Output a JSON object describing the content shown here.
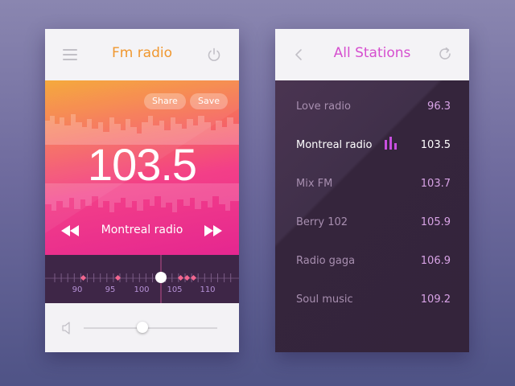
{
  "radio": {
    "title": "Fm radio",
    "share_label": "Share",
    "save_label": "Save",
    "frequency": "103.5",
    "station_name": "Montreal radio",
    "tuner_labels": [
      "90",
      "95",
      "100",
      "105",
      "110"
    ],
    "volume_fraction": 0.44
  },
  "stations": {
    "title": "All Stations",
    "items": [
      {
        "name": "Love radio",
        "freq": "96.3"
      },
      {
        "name": "Montreal radio",
        "freq": "103.5",
        "active": true
      },
      {
        "name": "Mix FM",
        "freq": "103.7"
      },
      {
        "name": "Berry 102",
        "freq": "105.9"
      },
      {
        "name": "Radio gaga",
        "freq": "106.9"
      },
      {
        "name": "Soul music",
        "freq": "109.2"
      }
    ]
  },
  "colors": {
    "accent_orange": "#f0972f",
    "accent_pink": "#d64fcf",
    "tuner_bg": "#3e2647",
    "list_bg": "#3b2942"
  },
  "icons": {
    "menu": "menu-icon",
    "power": "power-icon",
    "rewind": "rewind-icon",
    "forward": "fast-forward-icon",
    "volume": "volume-icon",
    "back": "back-icon",
    "refresh": "refresh-icon",
    "equalizer": "equalizer-icon"
  }
}
